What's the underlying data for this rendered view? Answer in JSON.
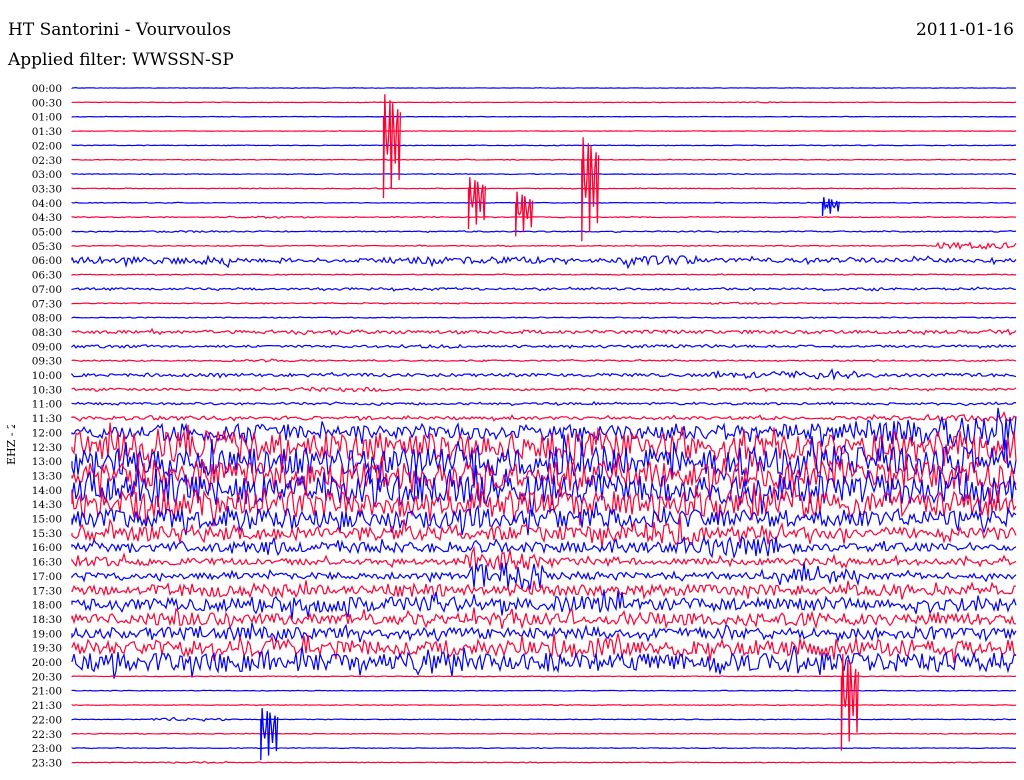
{
  "header": {
    "station": "HT Santorini - Vourvoulos",
    "date": "2011-01-16",
    "filter": "Applied filter: WWSSN-SP"
  },
  "chart_data": {
    "type": "line",
    "title": "HT Santorini - Vourvoulos",
    "ylabel": "EHZ - 20000",
    "xlabel": "",
    "grid": false,
    "legend": "none",
    "row_labels": [
      "00:00",
      "00:30",
      "01:00",
      "01:30",
      "02:00",
      "02:30",
      "03:00",
      "03:30",
      "04:00",
      "04:30",
      "05:00",
      "05:30",
      "06:00",
      "06:30",
      "07:00",
      "07:30",
      "08:00",
      "08:30",
      "09:00",
      "09:30",
      "10:00",
      "10:30",
      "11:00",
      "11:30",
      "12:00",
      "12:30",
      "13:00",
      "13:30",
      "14:00",
      "14:30",
      "15:00",
      "15:30",
      "16:00",
      "16:30",
      "17:00",
      "17:30",
      "18:00",
      "18:30",
      "19:00",
      "19:30",
      "20:00",
      "20:30",
      "21:00",
      "21:30",
      "22:00",
      "22:30",
      "23:00",
      "23:30"
    ],
    "series": [
      {
        "color": "#0000ff",
        "values": [
          0.02,
          0.02,
          0.02,
          0.02,
          0.02,
          0.02,
          0.02,
          0.02,
          0.02,
          0.02,
          0.02,
          0.02
        ]
      },
      {
        "color": "#ff0033",
        "values": [
          0.02,
          0.02,
          0.02,
          0.02,
          0.02,
          0.02,
          0.02,
          0.02,
          0.04,
          0.02,
          0.02,
          0.02
        ]
      },
      {
        "color": "#0000ff",
        "values": [
          0.02,
          0.02,
          0.02,
          0.02,
          0.02,
          0.02,
          0.02,
          0.02,
          0.02,
          0.02,
          0.02,
          0.02
        ]
      },
      {
        "color": "#ff0033",
        "values": [
          0.02,
          0.02,
          0.02,
          0.02,
          0.02,
          0.02,
          0.02,
          0.02,
          0.02,
          0.02,
          0.02,
          0.02
        ]
      },
      {
        "color": "#0000ff",
        "values": [
          0.03,
          0.03,
          0.03,
          0.03,
          0.03,
          0.03,
          0.03,
          0.03,
          0.03,
          0.03,
          0.03,
          0.03
        ]
      },
      {
        "color": "#ff0033",
        "values": [
          0.03,
          0.03,
          0.03,
          0.03,
          0.03,
          0.03,
          0.03,
          0.03,
          0.03,
          0.03,
          0.03,
          0.03
        ]
      },
      {
        "color": "#0000ff",
        "values": [
          0.03,
          0.03,
          0.03,
          0.03,
          0.03,
          0.03,
          0.03,
          0.03,
          0.03,
          0.03,
          0.03,
          0.03
        ]
      },
      {
        "color": "#ff0033",
        "values": [
          0.03,
          0.03,
          0.03,
          0.03,
          0.03,
          0.03,
          0.03,
          0.03,
          0.03,
          0.03,
          0.03,
          0.03
        ]
      },
      {
        "color": "#0000ff",
        "values": [
          0.03,
          0.03,
          0.03,
          0.03,
          0.03,
          0.03,
          0.03,
          0.03,
          0.03,
          0.03,
          0.03,
          0.03
        ]
      },
      {
        "color": "#ff0033",
        "values": [
          0.04,
          0.04,
          0.1,
          0.04,
          0.04,
          0.04,
          0.04,
          0.04,
          0.04,
          0.04,
          0.04,
          0.04
        ]
      },
      {
        "color": "#0000ff",
        "values": [
          0.05,
          0.08,
          0.05,
          0.05,
          0.05,
          0.05,
          0.05,
          0.05,
          0.05,
          0.05,
          0.05,
          0.05
        ]
      },
      {
        "color": "#ff0033",
        "values": [
          0.04,
          0.04,
          0.04,
          0.04,
          0.04,
          0.04,
          0.04,
          0.04,
          0.04,
          0.04,
          0.04,
          0.3
        ]
      },
      {
        "color": "#0000ff",
        "values": [
          0.3,
          0.4,
          0.2,
          0.2,
          0.3,
          0.3,
          0.2,
          0.4,
          0.2,
          0.2,
          0.2,
          0.2
        ]
      },
      {
        "color": "#ff0033",
        "values": [
          0.04,
          0.04,
          0.04,
          0.04,
          0.04,
          0.04,
          0.04,
          0.04,
          0.04,
          0.04,
          0.04,
          0.04
        ]
      },
      {
        "color": "#0000ff",
        "values": [
          0.1,
          0.1,
          0.1,
          0.1,
          0.1,
          0.1,
          0.1,
          0.1,
          0.1,
          0.1,
          0.1,
          0.1
        ]
      },
      {
        "color": "#ff0033",
        "values": [
          0.04,
          0.04,
          0.04,
          0.04,
          0.04,
          0.04,
          0.04,
          0.04,
          0.1,
          0.04,
          0.04,
          0.04
        ]
      },
      {
        "color": "#0000ff",
        "values": [
          0.04,
          0.04,
          0.04,
          0.04,
          0.04,
          0.04,
          0.04,
          0.04,
          0.04,
          0.04,
          0.04,
          0.04
        ]
      },
      {
        "color": "#ff0033",
        "values": [
          0.15,
          0.15,
          0.15,
          0.15,
          0.15,
          0.15,
          0.15,
          0.15,
          0.15,
          0.15,
          0.15,
          0.15
        ]
      },
      {
        "color": "#0000ff",
        "values": [
          0.15,
          0.1,
          0.1,
          0.1,
          0.15,
          0.1,
          0.1,
          0.15,
          0.1,
          0.1,
          0.1,
          0.1
        ]
      },
      {
        "color": "#ff0033",
        "values": [
          0.06,
          0.06,
          0.1,
          0.06,
          0.06,
          0.06,
          0.06,
          0.06,
          0.06,
          0.06,
          0.06,
          0.06
        ]
      },
      {
        "color": "#0000ff",
        "values": [
          0.15,
          0.15,
          0.15,
          0.15,
          0.15,
          0.15,
          0.15,
          0.15,
          0.3,
          0.35,
          0.15,
          0.15
        ]
      },
      {
        "color": "#ff0033",
        "values": [
          0.1,
          0.1,
          0.1,
          0.2,
          0.1,
          0.1,
          0.1,
          0.1,
          0.1,
          0.1,
          0.1,
          0.1
        ]
      },
      {
        "color": "#0000ff",
        "values": [
          0.1,
          0.1,
          0.1,
          0.1,
          0.1,
          0.1,
          0.1,
          0.1,
          0.1,
          0.1,
          0.1,
          0.1
        ]
      },
      {
        "color": "#ff0033",
        "values": [
          0.15,
          0.2,
          0.15,
          0.15,
          0.15,
          0.15,
          0.15,
          0.15,
          0.15,
          0.15,
          0.2,
          0.3
        ]
      },
      {
        "color": "#0000ff",
        "values": [
          0.6,
          0.8,
          0.8,
          0.6,
          0.6,
          0.7,
          0.7,
          0.6,
          0.7,
          0.8,
          1.2,
          1.5
        ]
      },
      {
        "color": "#ff0033",
        "values": [
          1.4,
          1.5,
          1.4,
          1.3,
          1.3,
          1.3,
          1.4,
          1.3,
          1.3,
          1.4,
          1.4,
          1.5
        ]
      },
      {
        "color": "#0000ff",
        "values": [
          1.3,
          1.4,
          1.3,
          1.2,
          1.3,
          1.3,
          1.4,
          1.3,
          1.3,
          1.5,
          1.3,
          1.3
        ]
      },
      {
        "color": "#ff0033",
        "values": [
          1.2,
          1.5,
          1.3,
          1.2,
          1.3,
          1.2,
          1.3,
          1.2,
          1.3,
          1.4,
          1.3,
          1.3
        ]
      },
      {
        "color": "#0000ff",
        "values": [
          1.3,
          1.5,
          1.4,
          1.3,
          1.4,
          1.4,
          1.5,
          1.3,
          1.3,
          1.4,
          1.3,
          1.3
        ]
      },
      {
        "color": "#ff0033",
        "values": [
          1.3,
          1.4,
          1.3,
          1.2,
          1.2,
          1.3,
          1.2,
          1.2,
          1.2,
          1.3,
          1.1,
          1.2
        ]
      },
      {
        "color": "#0000ff",
        "values": [
          0.8,
          0.9,
          0.9,
          0.8,
          0.9,
          0.9,
          0.9,
          0.8,
          0.8,
          0.8,
          0.7,
          0.7
        ]
      },
      {
        "color": "#ff0033",
        "values": [
          0.8,
          0.7,
          0.7,
          0.6,
          0.7,
          0.7,
          0.8,
          1.1,
          0.7,
          0.6,
          0.5,
          0.5
        ]
      },
      {
        "color": "#0000ff",
        "values": [
          0.4,
          0.4,
          0.5,
          0.5,
          0.5,
          0.5,
          0.5,
          0.5,
          1.0,
          0.4,
          0.4,
          0.3
        ]
      },
      {
        "color": "#ff0033",
        "values": [
          0.4,
          0.3,
          0.3,
          0.3,
          0.3,
          0.9,
          0.4,
          0.3,
          0.3,
          0.3,
          0.3,
          0.3
        ]
      },
      {
        "color": "#0000ff",
        "values": [
          0.3,
          0.3,
          0.3,
          0.3,
          0.3,
          1.3,
          0.4,
          0.3,
          0.3,
          0.7,
          0.3,
          0.3
        ]
      },
      {
        "color": "#ff0033",
        "values": [
          0.4,
          0.6,
          0.6,
          0.4,
          0.6,
          0.5,
          0.5,
          0.5,
          0.5,
          0.5,
          0.5,
          0.4
        ]
      },
      {
        "color": "#0000ff",
        "values": [
          0.5,
          0.6,
          0.8,
          0.7,
          0.7,
          0.6,
          0.8,
          0.6,
          0.6,
          0.6,
          0.5,
          0.6
        ]
      },
      {
        "color": "#ff0033",
        "values": [
          0.5,
          0.6,
          0.5,
          0.5,
          0.5,
          0.6,
          0.5,
          0.6,
          0.5,
          0.6,
          0.5,
          0.5
        ]
      },
      {
        "color": "#0000ff",
        "values": [
          0.5,
          0.6,
          0.6,
          0.5,
          0.5,
          0.5,
          0.5,
          0.5,
          0.5,
          0.5,
          0.6,
          0.5
        ]
      },
      {
        "color": "#ff0033",
        "values": [
          0.6,
          0.7,
          0.8,
          0.7,
          0.7,
          0.7,
          0.9,
          0.7,
          0.7,
          0.8,
          0.8,
          0.8
        ]
      },
      {
        "color": "#0000ff",
        "values": [
          0.9,
          0.8,
          0.9,
          0.8,
          0.9,
          0.8,
          0.9,
          0.8,
          0.8,
          0.9,
          0.8,
          0.9
        ]
      },
      {
        "color": "#ff0033",
        "values": [
          0.03,
          0.03,
          0.03,
          0.03,
          0.03,
          0.03,
          0.03,
          0.03,
          0.03,
          0.03,
          0.03,
          0.03
        ]
      },
      {
        "color": "#0000ff",
        "values": [
          0.03,
          0.03,
          0.03,
          0.03,
          0.03,
          0.03,
          0.03,
          0.03,
          0.03,
          0.03,
          0.03,
          0.03
        ]
      },
      {
        "color": "#ff0033",
        "values": [
          0.03,
          0.03,
          0.03,
          0.03,
          0.03,
          0.03,
          0.03,
          0.03,
          0.03,
          0.03,
          0.03,
          0.03
        ]
      },
      {
        "color": "#0000ff",
        "values": [
          0.03,
          0.1,
          0.03,
          0.03,
          0.03,
          0.03,
          0.03,
          0.03,
          0.03,
          0.03,
          0.03,
          0.03
        ]
      },
      {
        "color": "#ff0033",
        "values": [
          0.03,
          0.03,
          0.03,
          0.03,
          0.03,
          0.03,
          0.03,
          0.03,
          0.03,
          0.03,
          0.03,
          0.03
        ]
      },
      {
        "color": "#0000ff",
        "values": [
          0.03,
          0.03,
          0.03,
          0.03,
          0.03,
          0.03,
          0.03,
          0.03,
          0.03,
          0.03,
          0.03,
          0.03
        ]
      },
      {
        "color": "#ff0033",
        "values": [
          0.03,
          0.05,
          0.03,
          0.03,
          0.03,
          0.03,
          0.03,
          0.03,
          0.03,
          0.03,
          0.03,
          0.03
        ]
      }
    ],
    "events": [
      {
        "row": 2,
        "x": 0.33,
        "amp": 8,
        "color": "#ff0033",
        "rows_down": 8
      },
      {
        "row": 5,
        "x": 0.54,
        "amp": 8,
        "color": "#ff0033",
        "rows_down": 8
      },
      {
        "row": 7,
        "x": 0.42,
        "amp": 4,
        "color": "#ff0033",
        "rows_down": 4
      },
      {
        "row": 8,
        "x": 0.47,
        "amp": 4,
        "color": "#ff0033",
        "rows_down": 3
      },
      {
        "row": 8,
        "x": 0.795,
        "amp": 2,
        "color": "#0000ff",
        "rows_down": 1
      },
      {
        "row": 44,
        "x": 0.2,
        "amp": 4,
        "color": "#0000ff",
        "rows_down": 4
      },
      {
        "row": 41,
        "x": 0.815,
        "amp": 8,
        "color": "#ff0033",
        "rows_down": 7
      }
    ],
    "ylim": [
      -1,
      1
    ]
  }
}
